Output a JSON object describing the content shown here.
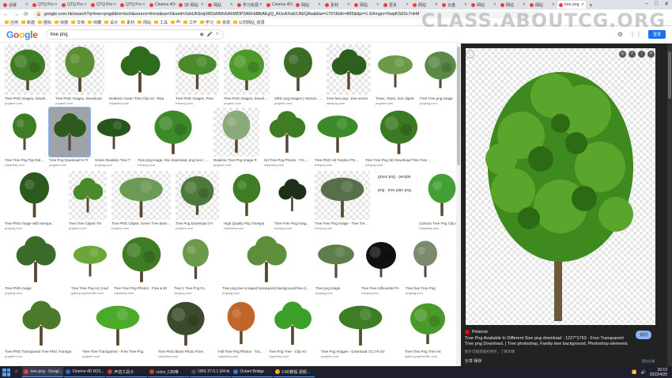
{
  "browser": {
    "tabs": [
      {
        "label": "谷歌"
      },
      {
        "label": "QTQ Pro"
      },
      {
        "label": "QTQ Pro"
      },
      {
        "label": "QTQ Pro"
      },
      {
        "label": "QTQ Pro"
      },
      {
        "label": "Cinema 4D"
      },
      {
        "label": "3D 网站"
      },
      {
        "label": "网站"
      },
      {
        "label": "学习资源"
      },
      {
        "label": "Cinema 4D"
      },
      {
        "label": "网站"
      },
      {
        "label": "素材"
      },
      {
        "label": "网站"
      },
      {
        "label": "更多"
      },
      {
        "label": "网站"
      },
      {
        "label": "云盘"
      },
      {
        "label": "网站"
      },
      {
        "label": "网站"
      },
      {
        "label": "网站"
      },
      {
        "label": "tree png",
        "active": true
      }
    ],
    "url": "google.com.hk/search?q=tree+png&tbm=isch&source=lnms&sa=X&ved=2ahUKEwjX8OzMt9v5AhWDP3AKHd8bAEgQ_AUoAXoECAEQAw&biw=1707&bih=865&dpr=1.5#imgrc=5wpKSE5c7nlrM",
    "bookmarks": [
      "应用",
      "新建",
      "图标",
      "快捷",
      "文档",
      "收藏",
      "设计",
      "素材",
      "网站",
      "工具",
      "AI",
      "工作",
      "学习",
      "资源",
      "公司网站_收录"
    ]
  },
  "watermark": "CLASS.ABOUTCG.ORG",
  "google": {
    "logo": [
      "G",
      "o",
      "o",
      "g",
      "l",
      "e"
    ],
    "query": "tree png",
    "signin": "登录"
  },
  "results": [
    {
      "title": "Tree PNG Images, Download",
      "source": "pngtree.com",
      "color": "#3f7d25",
      "checker": true
    },
    {
      "title": "Tree PNG Images, Download",
      "source": "pngtree.com",
      "color": "#5c8f34",
      "checker": true
    },
    {
      "title": "Realistic Green Tree Clip Art - Rea",
      "source": "clipartkey.com",
      "color": "#2f6b1c",
      "checker": false
    },
    {
      "title": "Tree PNG Images, Free",
      "source": "freepng.com",
      "color": "#4b8a2c",
      "checker": true
    },
    {
      "title": "Tree PNG Images, Download",
      "source": "pngtree.com",
      "color": "#4c9a2a",
      "checker": true
    },
    {
      "title": "ORG png Images | Vectors | Photo",
      "source": "pngtree.com",
      "color": "#3b6d25",
      "checker": false
    },
    {
      "title": "Tree free png - tree vector",
      "source": "stickpng.com",
      "color": "#2e5f1f",
      "checker": true
    },
    {
      "title": "Trees, Trees, tree clipart",
      "source": "pngtree.com",
      "color": "#6b9a4a",
      "checker": false
    },
    {
      "title": "Free Tree png image",
      "source": "pngimg.com",
      "color": "#5a8a46",
      "checker": false
    },
    {
      "title": "Tree Tree Png Top Rated",
      "source": "clipartkey.com",
      "color": "#3f7d25",
      "checker": false
    },
    {
      "title": "Tree Png Download In Tr",
      "source": "pngtree.com",
      "color": "#2e5a1f",
      "checker": false,
      "selected": true
    },
    {
      "title": "Green Realistic Tree T",
      "source": "pngimg.com",
      "color": "#27561a",
      "checker": false
    },
    {
      "title": "Tree png image, free download, png tree | Tree",
      "source": "freepng.com",
      "color": "#3c8a2a",
      "checker": false
    },
    {
      "title": "Realistic Tree Png Image R",
      "source": "pngtree.com",
      "color": "#8aaa7a",
      "checker": true
    },
    {
      "title": "Hd Tree Png Photos - Tree Png",
      "source": "clipartkey.com",
      "color": "#3f7d25",
      "checker": false
    },
    {
      "title": "Tree PNG Hd Tracker PNG Mobile Graphics D",
      "source": "freepng.com",
      "color": "#3c8a2a",
      "checker": false
    },
    {
      "title": "Tree Tree Png HD Download Tree Free Pn",
      "source": "freepng.com",
      "color": "#3a7a22",
      "checker": false
    },
    {
      "title": "Tree PNG image with transpa",
      "source": "pngimg.com",
      "color": "#2c5a1c",
      "checker": false
    },
    {
      "title": "Tree Tree Clipart Tre",
      "source": "pngtree.com",
      "color": "#4b8a2c",
      "checker": true
    },
    {
      "title": "Tree PNG Clipart, Green Tree Branch",
      "source": "pngtree.com",
      "color": "#6a9a54",
      "checker": true
    },
    {
      "title": "Tree Png Download | Fr",
      "source": "pngtree.com",
      "color": "#4d7a3a",
      "checker": true
    },
    {
      "title": "High Quality Png Transpa",
      "source": "clipartkey.com",
      "color": "#3f7d25",
      "checker": false
    },
    {
      "title": "Tree Free Png Image? Tr",
      "source": "freepng.com",
      "color": "#1f2f1a",
      "checker": false
    },
    {
      "title": "Tree Free Png Image - Tree Tree P",
      "source": "freepng.com",
      "color": "#55704a",
      "checker": true
    },
    {
      "title": "grass png · people png · tree plan png",
      "source": "",
      "color": "#3a7a22",
      "checker": false,
      "related": true
    },
    {
      "title": "Cartoon Tree Png Clip Art",
      "source": "clipartkey.com",
      "color": "#43a034",
      "checker": false
    },
    {
      "title": "Tree PNG image",
      "source": "pngimg.com",
      "color": "#3a6b28",
      "checker": false
    },
    {
      "title": "Tree Tree Png Art | roof",
      "source": "gallery.yopriceville.com",
      "color": "#6aa63a",
      "checker": false
    },
    {
      "title": "Tree Tree Png Photos - Free & Bl",
      "source": "clipartkey.com",
      "color": "#3f7d25",
      "checker": false
    },
    {
      "title": "Tree 1 Tree Png Fu",
      "source": "kisspng.com",
      "color": "#6b9a4a",
      "checker": false
    },
    {
      "title": "Tree png tree scraped transparent background free download",
      "source": "pngimg.com",
      "color": "#5d8f3a",
      "checker": false
    },
    {
      "title": "Tree png image",
      "source": "pngimg.com",
      "color": "#5e7e4a",
      "checker": false
    },
    {
      "title": "Tree Free Silhouette Pn",
      "source": "freepng.com",
      "color": "#111111",
      "checker": false
    },
    {
      "title": "Tree free Tree Png",
      "source": "pngimg.com",
      "color": "#7a8a6a",
      "checker": false
    },
    {
      "title": "Tree PNG Transparent Tree PNG Transpa",
      "source": "pngtree.com",
      "color": "#4a7a2a",
      "checker": false
    },
    {
      "title": "Tree Tree Transparent - Free Tree Png",
      "source": "pngtree.com",
      "color": "#4caa2a",
      "checker": false
    },
    {
      "title": "Tree PNG Black Photo From",
      "source": "clipartkey.com",
      "color": "#3a4a2a",
      "checker": false
    },
    {
      "title": "Fall Tree Png Photos - Transparent",
      "source": "clipartkey.com",
      "color": "#c0662a",
      "checker": false
    },
    {
      "title": "Tree Png Tree - Clip Art",
      "source": "clipartkey.com",
      "color": "#3aa02a",
      "checker": false
    },
    {
      "title": "Tree Png Images - Download 73,179 Ge",
      "source": "pngtree.com",
      "color": "#3f7d25",
      "checker": false
    },
    {
      "title": "Tree Tree Png Tree Art",
      "source": "gallery.yopriceville.com",
      "color": "#4a9a2a",
      "checker": false
    }
  ],
  "preview": {
    "source": "Pinterest",
    "title": "Tree Png Available In Different Size png download - 1227*1763 - Free Transparent Tree png Download. | Tree photoshop, Family tree background, Photoshop elements",
    "meta": "图片可能受版权保护。了解详情",
    "visit": "访问",
    "share": "分享 保存",
    "feedback": "提交反馈"
  },
  "taskbar": {
    "items": [
      {
        "label": "tree png - Googl...",
        "color": "#ea4335",
        "active": true
      },
      {
        "label": "Cinema 4D R23...",
        "color": "#1e6bd6",
        "active": false
      },
      {
        "label": "声音工具:0",
        "color": "#c43e3e",
        "active": false
      },
      {
        "label": "cn/cn_C四维",
        "color": "#b84a2a",
        "active": false
      },
      {
        "label": "OBS 27.0.1 (64-bi...",
        "color": "#4a4a4a",
        "active": false
      },
      {
        "label": "Octant Bridge",
        "color": "#2f7ad6",
        "active": false
      },
      {
        "label": "C4D教程 视频...",
        "color": "#ffb100",
        "active": false
      }
    ],
    "time": "20:10",
    "date": "2022/4/20"
  }
}
